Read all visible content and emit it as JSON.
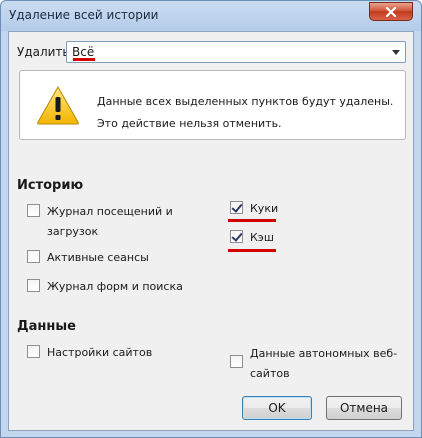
{
  "window": {
    "title": "Удаление всей истории"
  },
  "delete_row": {
    "label": "Удалить:",
    "selected": "Всё"
  },
  "warning": {
    "line1": "Данные всех выделенных пунктов будут удалены.",
    "line2": "Это действие нельзя отменить."
  },
  "history": {
    "title": "Историю",
    "items": [
      {
        "label_line1": "Журнал посещений и",
        "label_line2": "загрузок",
        "checked": false
      },
      {
        "label": "Активные сеансы",
        "checked": false
      },
      {
        "label": "Журнал форм и поиска",
        "checked": false
      },
      {
        "label": "Куки",
        "checked": true
      },
      {
        "label": "Кэш",
        "checked": true
      }
    ]
  },
  "data": {
    "title": "Данные",
    "items": [
      {
        "label": "Настройки сайтов",
        "checked": false
      },
      {
        "label_line1": "Данные автономных веб-",
        "label_line2": "сайтов",
        "checked": false
      }
    ]
  },
  "buttons": {
    "ok": "OK",
    "cancel": "Отмена"
  },
  "colors": {
    "annotation_red": "#d40000",
    "titlebar": "#c9dcf1",
    "close": "#c23a1d"
  }
}
